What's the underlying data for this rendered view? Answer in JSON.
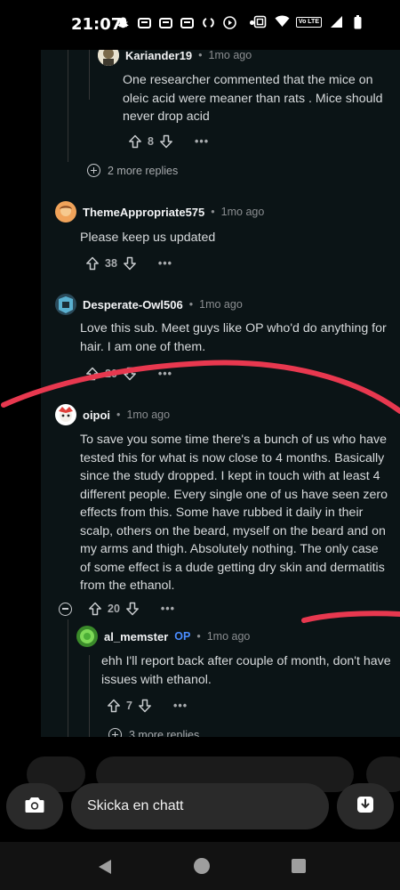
{
  "status_bar": {
    "time": "21:07",
    "volte": "Vo LTE",
    "icons_left": [
      "snapchat-icon",
      "message-icon",
      "message-icon",
      "message-icon",
      "sync-icon",
      "media-icon",
      "dot"
    ],
    "icons_right": [
      "screenshot-icon",
      "wifi-icon",
      "volte-icon",
      "signal-icon",
      "battery-icon"
    ]
  },
  "comments": [
    {
      "user": "Kariander19",
      "time": "1mo ago",
      "text": "One researcher commented that the mice on oleic acid were meaner than rats . Mice should never drop acid",
      "votes": "8"
    },
    {
      "more_replies": "2 more replies"
    },
    {
      "user": "ThemeAppropriate575",
      "time": "1mo ago",
      "text": "Please keep us updated",
      "votes": "38"
    },
    {
      "user": "Desperate-Owl506",
      "time": "1mo ago",
      "text": "Love this sub. Meet guys like OP who'd do anything for hair. I am one of them.",
      "votes": "20"
    },
    {
      "user": "oipoi",
      "time": "1mo ago",
      "text": "To save you some time there's a bunch of us who have tested this for what is now close to 4 months. Basically since the study dropped. I kept in touch with at least 4 different people. Every single one of us have seen zero effects from this. Some have rubbed it daily in their scalp, others on the beard, myself on the beard and on my arms and thigh. Absolutely nothing. The only case of some effect is a dude getting dry skin and dermatitis from the ethanol.",
      "votes": "20"
    },
    {
      "user": "al_memster",
      "badge": "OP",
      "time": "1mo ago",
      "text": "ehh I'll report back after couple of month, don't have issues with ethanol.",
      "votes": "7"
    },
    {
      "more_replies": "3 more replies"
    }
  ],
  "separator": "•",
  "more_label": "•••",
  "chat": {
    "placeholder": "Skicka en chatt"
  },
  "colors": {
    "background": "#0b1416",
    "annotation": "#e8384f",
    "op_badge": "#4a8cff"
  }
}
